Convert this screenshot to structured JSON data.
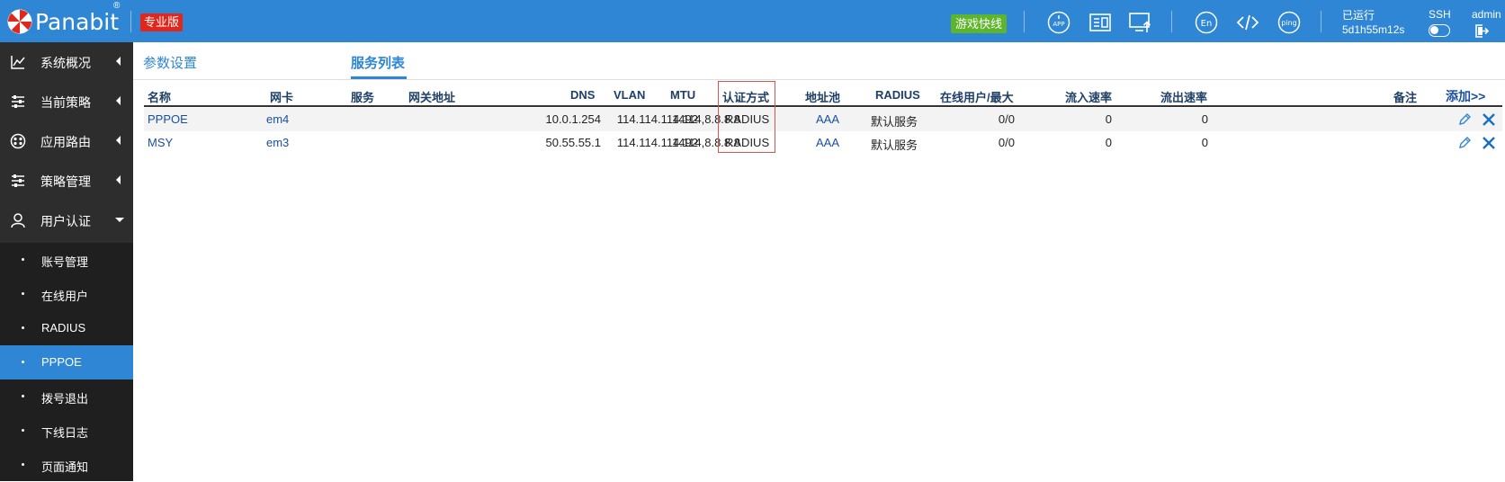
{
  "header": {
    "brand": "Panabit",
    "brand_mark": "®",
    "edition_badge": "专业版",
    "game_badge": "游戏快线",
    "icons": [
      "app-icon",
      "document-icon",
      "monitor-upload-icon",
      "language-en-icon",
      "code-icon",
      "ping-icon"
    ],
    "uptime_label": "已运行",
    "uptime_value": "5d1h55m12s",
    "ssh_label": "SSH",
    "user_label": "admin",
    "colors": {
      "header_bg": "#2e86d4",
      "edition_badge_bg": "#e1261c",
      "game_badge_bg": "#5cb52a"
    }
  },
  "sidebar": {
    "items": [
      {
        "label": "系统概况",
        "icon": "chart-icon"
      },
      {
        "label": "当前策略",
        "icon": "sliders-icon"
      },
      {
        "label": "应用路由",
        "icon": "route-icon"
      },
      {
        "label": "策略管理",
        "icon": "sliders-icon"
      },
      {
        "label": "用户认证",
        "icon": "user-icon",
        "expanded": true
      }
    ],
    "sub_items": [
      {
        "label": "账号管理"
      },
      {
        "label": "在线用户"
      },
      {
        "label": "RADIUS"
      },
      {
        "label": "PPPOE",
        "active": true
      },
      {
        "label": "拨号退出"
      },
      {
        "label": "下线日志"
      },
      {
        "label": "页面通知"
      }
    ],
    "colors": {
      "bg": "#2d2d2d",
      "sub_bg": "#1f1f1f",
      "active_bg": "#2e86d4"
    }
  },
  "tabs": [
    {
      "label": "参数设置"
    },
    {
      "label": "服务列表",
      "active": true
    }
  ],
  "table": {
    "columns": {
      "name": "名称",
      "nic": "网卡",
      "service": "服务",
      "gateway": "网关地址",
      "dns": "DNS",
      "vlan": "VLAN",
      "mtu": "MTU",
      "auth": "认证方式",
      "pool": "地址池",
      "radius": "RADIUS",
      "online": "在线用户/最大",
      "in_rate": "流入速率",
      "out_rate": "流出速率",
      "remark": "备注",
      "add": "添加>>"
    },
    "rows": [
      {
        "name": "PPPOE",
        "nic": "em4",
        "service": "",
        "gateway": "10.0.1.254",
        "dns": "114.114.114.114,8.8.8.8",
        "vlan": "",
        "mtu": "1492",
        "auth": "RADIUS",
        "pool": "AAA",
        "radius": "默认服务",
        "online": "0/0",
        "in_rate": "0",
        "out_rate": "0",
        "remark": ""
      },
      {
        "name": "MSY",
        "nic": "em3",
        "service": "",
        "gateway": "50.55.55.1",
        "dns": "114.114.114.114,8.8.8.8",
        "vlan": "",
        "mtu": "1492",
        "auth": "RADIUS",
        "pool": "AAA",
        "radius": "默认服务",
        "online": "0/0",
        "in_rate": "0",
        "out_rate": "0",
        "remark": ""
      }
    ],
    "row_actions": [
      "edit-icon",
      "delete-icon"
    ],
    "colors": {
      "header_text": "#1e3f66",
      "link": "#1a4fa0",
      "highlight_box": "#d9534f"
    }
  }
}
